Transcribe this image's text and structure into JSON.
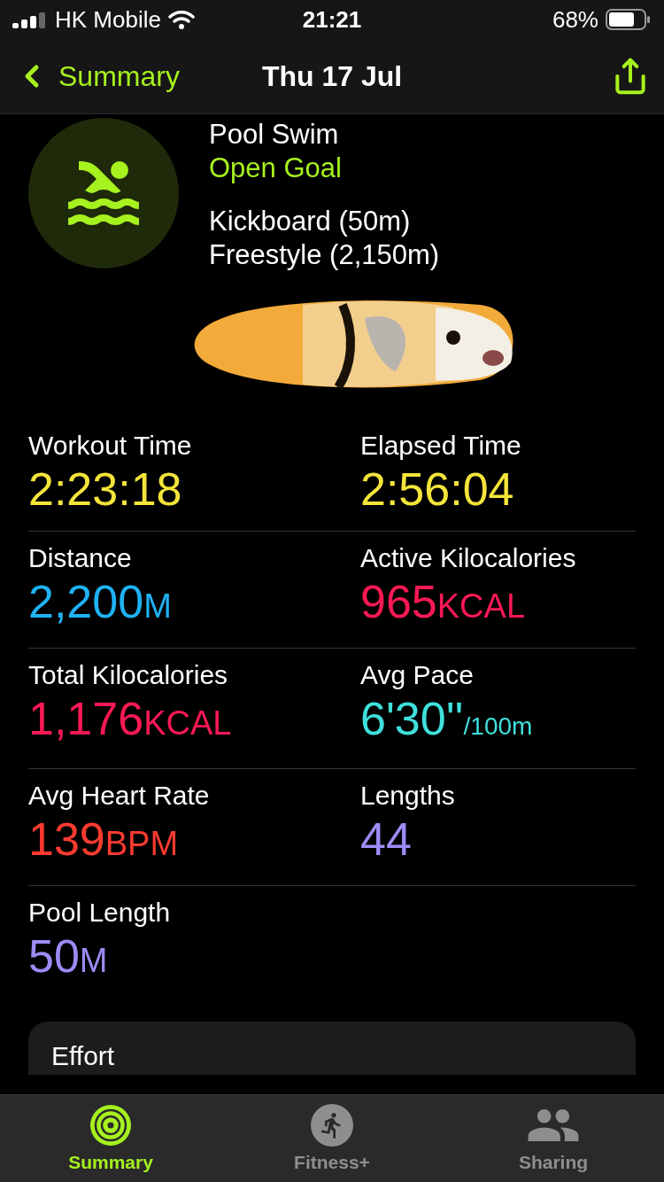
{
  "status_bar": {
    "carrier": "HK Mobile",
    "time": "21:21",
    "battery": "68%"
  },
  "nav": {
    "back": "Summary",
    "title": "Thu 17 Jul"
  },
  "workout": {
    "title": "Pool Swim",
    "goal": "Open Goal",
    "sets": [
      "Kickboard (50m)",
      "Freestyle (2,150m)"
    ]
  },
  "metrics": [
    {
      "label": "Workout Time",
      "value": "2:23:18",
      "color": "#f5e53a"
    },
    {
      "label": "Elapsed Time",
      "value": "2:56:04",
      "color": "#f5e53a"
    },
    {
      "label": "Distance",
      "value": "2,200",
      "unit": "M",
      "color": "#1fb2f5"
    },
    {
      "label": "Active Kilocalories",
      "value": "965",
      "unit": "KCAL",
      "color": "#fa1955"
    },
    {
      "label": "Total Kilocalories",
      "value": "1,176",
      "unit": "KCAL",
      "color": "#fa1955"
    },
    {
      "label": "Avg Pace",
      "value": "6'30''",
      "unit": "/100m",
      "color": "#3fe0dc"
    },
    {
      "label": "Avg Heart Rate",
      "value": "139",
      "unit": "BPM",
      "color": "#ff3b30"
    },
    {
      "label": "Lengths",
      "value": "44",
      "color": "#9b8cf5"
    },
    {
      "label": "Pool Length",
      "value": "50",
      "unit": "M",
      "color": "#9b8cf5"
    }
  ],
  "effort_card": {
    "title": "Effort"
  },
  "tabs": [
    {
      "label": "Summary",
      "selected": true
    },
    {
      "label": "Fitness+",
      "selected": false
    },
    {
      "label": "Sharing",
      "selected": false
    }
  ]
}
